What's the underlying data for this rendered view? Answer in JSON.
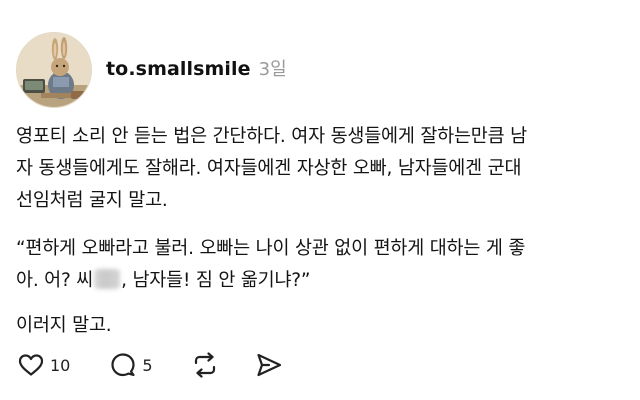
{
  "post": {
    "username": "to.smallsmile",
    "timestamp": "3일",
    "body": {
      "para1": [
        "영포티 소리 안 듣는 법은 간단하다. 여자 동생들에게 잘하는만큼 남",
        "자 동생들에게도 잘해라. 여자들에겐 자상한 오빠, 남자들에겐 군대",
        "선임처럼 굴지 말고."
      ],
      "para2": [
        "“편하게 오빠라고 불러. 오빠는 나이 상관 없이 편하게 대하는 게 좋",
        {
          "before": "아. 어? 씨",
          "after": ", 남자들! 짐 안 옮기냐?”"
        }
      ],
      "para3": "이러지 말고."
    },
    "actions": {
      "like": {
        "icon": "heart-icon",
        "count": "10"
      },
      "comment": {
        "icon": "comment-icon",
        "count": "5"
      },
      "repost": {
        "icon": "repost-icon"
      },
      "share": {
        "icon": "send-icon"
      }
    }
  }
}
